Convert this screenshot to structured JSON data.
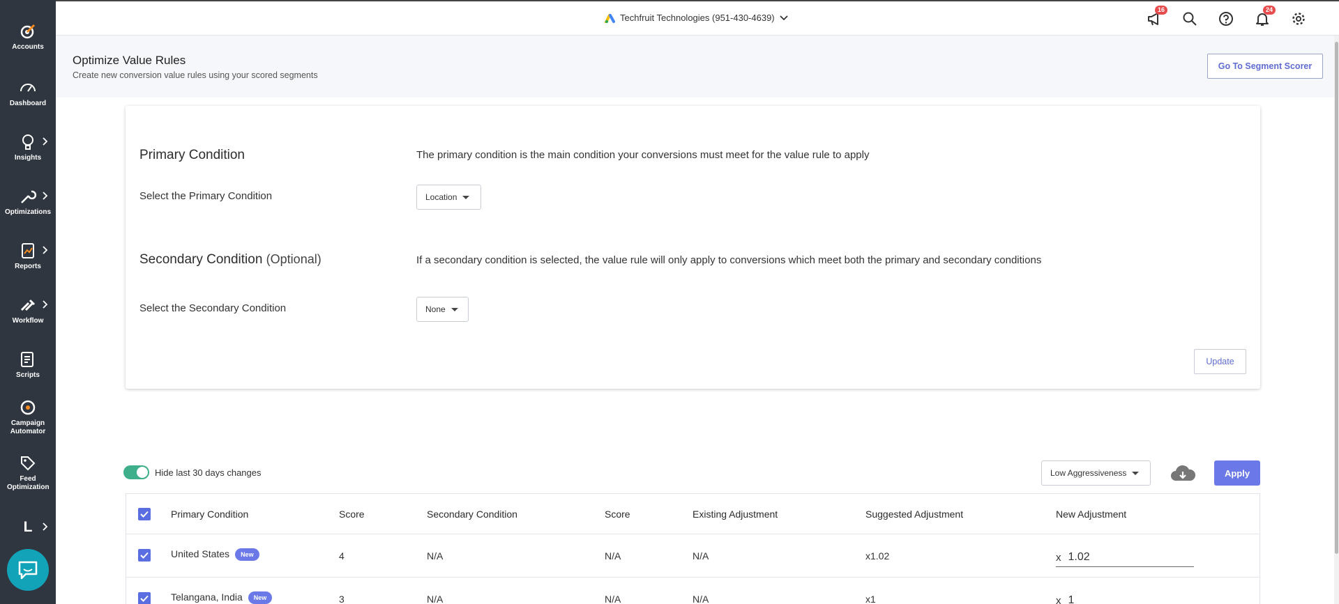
{
  "sidebar": {
    "items": [
      {
        "label": "Accounts",
        "icon": "target-logo-icon"
      },
      {
        "label": "Dashboard",
        "icon": "gauge-icon"
      },
      {
        "label": "Insights",
        "icon": "lightbulb-icon"
      },
      {
        "label": "Optimizations",
        "icon": "wrench-icon"
      },
      {
        "label": "Reports",
        "icon": "report-icon"
      },
      {
        "label": "Workflow",
        "icon": "tools-icon"
      },
      {
        "label": "Scripts",
        "icon": "script-icon"
      },
      {
        "label": "Campaign Automator",
        "icon": "automator-icon"
      },
      {
        "label": "Feed Optimization",
        "icon": "tag-icon"
      },
      {
        "label": "L",
        "icon": "user-initial"
      }
    ]
  },
  "topbar": {
    "account_name": "Techfruit Technologies (951-430-4639)",
    "announcements_count": "16",
    "notifications_count": "24"
  },
  "header": {
    "title": "Optimize Value Rules",
    "subtitle": "Create new conversion value rules using your scored segments",
    "segment_scorer_button": "Go To Segment Scorer"
  },
  "conditions": {
    "primary_title": "Primary Condition",
    "primary_desc": "The primary condition is the main condition your conversions must meet for the value rule to apply",
    "primary_select_label": "Select the Primary Condition",
    "primary_value": "Location",
    "secondary_title": "Secondary Condition",
    "secondary_optional": "(Optional)",
    "secondary_desc": "If a secondary condition is selected, the value rule will only apply to conversions which meet both the primary and secondary conditions",
    "secondary_select_label": "Select the Secondary Condition",
    "secondary_value": "None",
    "update_button": "Update"
  },
  "toolbar": {
    "toggle_label": "Hide last 30 days changes",
    "aggressiveness": "Low Aggressiveness",
    "apply_button": "Apply"
  },
  "table": {
    "columns": [
      "Primary Condition",
      "Score",
      "Secondary Condition",
      "Score",
      "Existing Adjustment",
      "Suggested Adjustment",
      "New Adjustment"
    ],
    "rows": [
      {
        "primary": "United States",
        "badge": "New",
        "score": "4",
        "secondary": "N/A",
        "secondary_score": "N/A",
        "existing": "N/A",
        "suggested": "x1.02",
        "new_prefix": "x",
        "new_value": "1.02"
      },
      {
        "primary": "Telangana, India",
        "badge": "New",
        "score": "3",
        "secondary": "N/A",
        "secondary_score": "N/A",
        "existing": "N/A",
        "suggested": "x1",
        "new_prefix": "x",
        "new_value": "1"
      }
    ]
  },
  "colors": {
    "sidebar": "#2f3640",
    "accent": "#6a78e8",
    "toggle_on": "#3fae8b",
    "badge_red": "#e74c4c",
    "chat": "#12a3b8"
  }
}
